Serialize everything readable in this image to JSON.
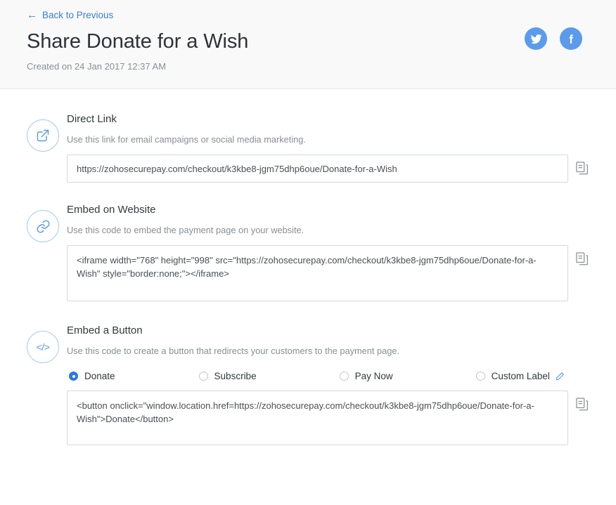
{
  "header": {
    "back_link": "Back to Previous",
    "back_icon": "arrow-left-icon",
    "title": "Share Donate for a Wish",
    "created_on": "Created on 24 Jan 2017 12:37 AM",
    "social": [
      {
        "name": "twitter-share-button",
        "icon": "twitter-icon",
        "label": "Twitter"
      },
      {
        "name": "facebook-share-button",
        "icon": "facebook-icon",
        "label": "Facebook"
      }
    ]
  },
  "sections": {
    "direct_link": {
      "icon": "external-link-icon",
      "title": "Direct Link",
      "description": "Use this link for email campaigns or social media marketing.",
      "value": "https://zohosecurepay.com/checkout/k3kbe8-jgm75dhp6oue/Donate-for-a-Wish",
      "copy_icon": "copy-icon"
    },
    "embed_website": {
      "icon": "link-chain-icon",
      "title": "Embed on Website",
      "description": "Use this code to embed the payment page on your website.",
      "value": "<iframe width=\"768\" height=\"998\" src=\"https://zohosecurepay.com/checkout/k3kbe8-jgm75dhp6oue/Donate-for-a-Wish\" style=\"border:none;\"></iframe>",
      "copy_icon": "copy-icon"
    },
    "embed_button": {
      "icon": "code-icon",
      "title": "Embed a Button",
      "description": "Use this code to create a button that redirects your customers to the payment page.",
      "options": [
        {
          "label": "Donate",
          "selected": true
        },
        {
          "label": "Subscribe",
          "selected": false
        },
        {
          "label": "Pay Now",
          "selected": false
        },
        {
          "label": "Custom Label",
          "selected": false
        }
      ],
      "edit_icon": "pencil-icon",
      "value": "<button onclick=\"window.location.href=https://zohosecurepay.com/checkout/k3kbe8-jgm75dhp6oue/Donate-for-a-Wish\">Donate</button>",
      "copy_icon": "copy-icon"
    }
  },
  "colors": {
    "accent": "#5b9bec",
    "link": "#3b7dd8",
    "radio_selected": "#2b7ae0",
    "header_bg": "#f9f9f9",
    "border": "#d6d9dc"
  }
}
